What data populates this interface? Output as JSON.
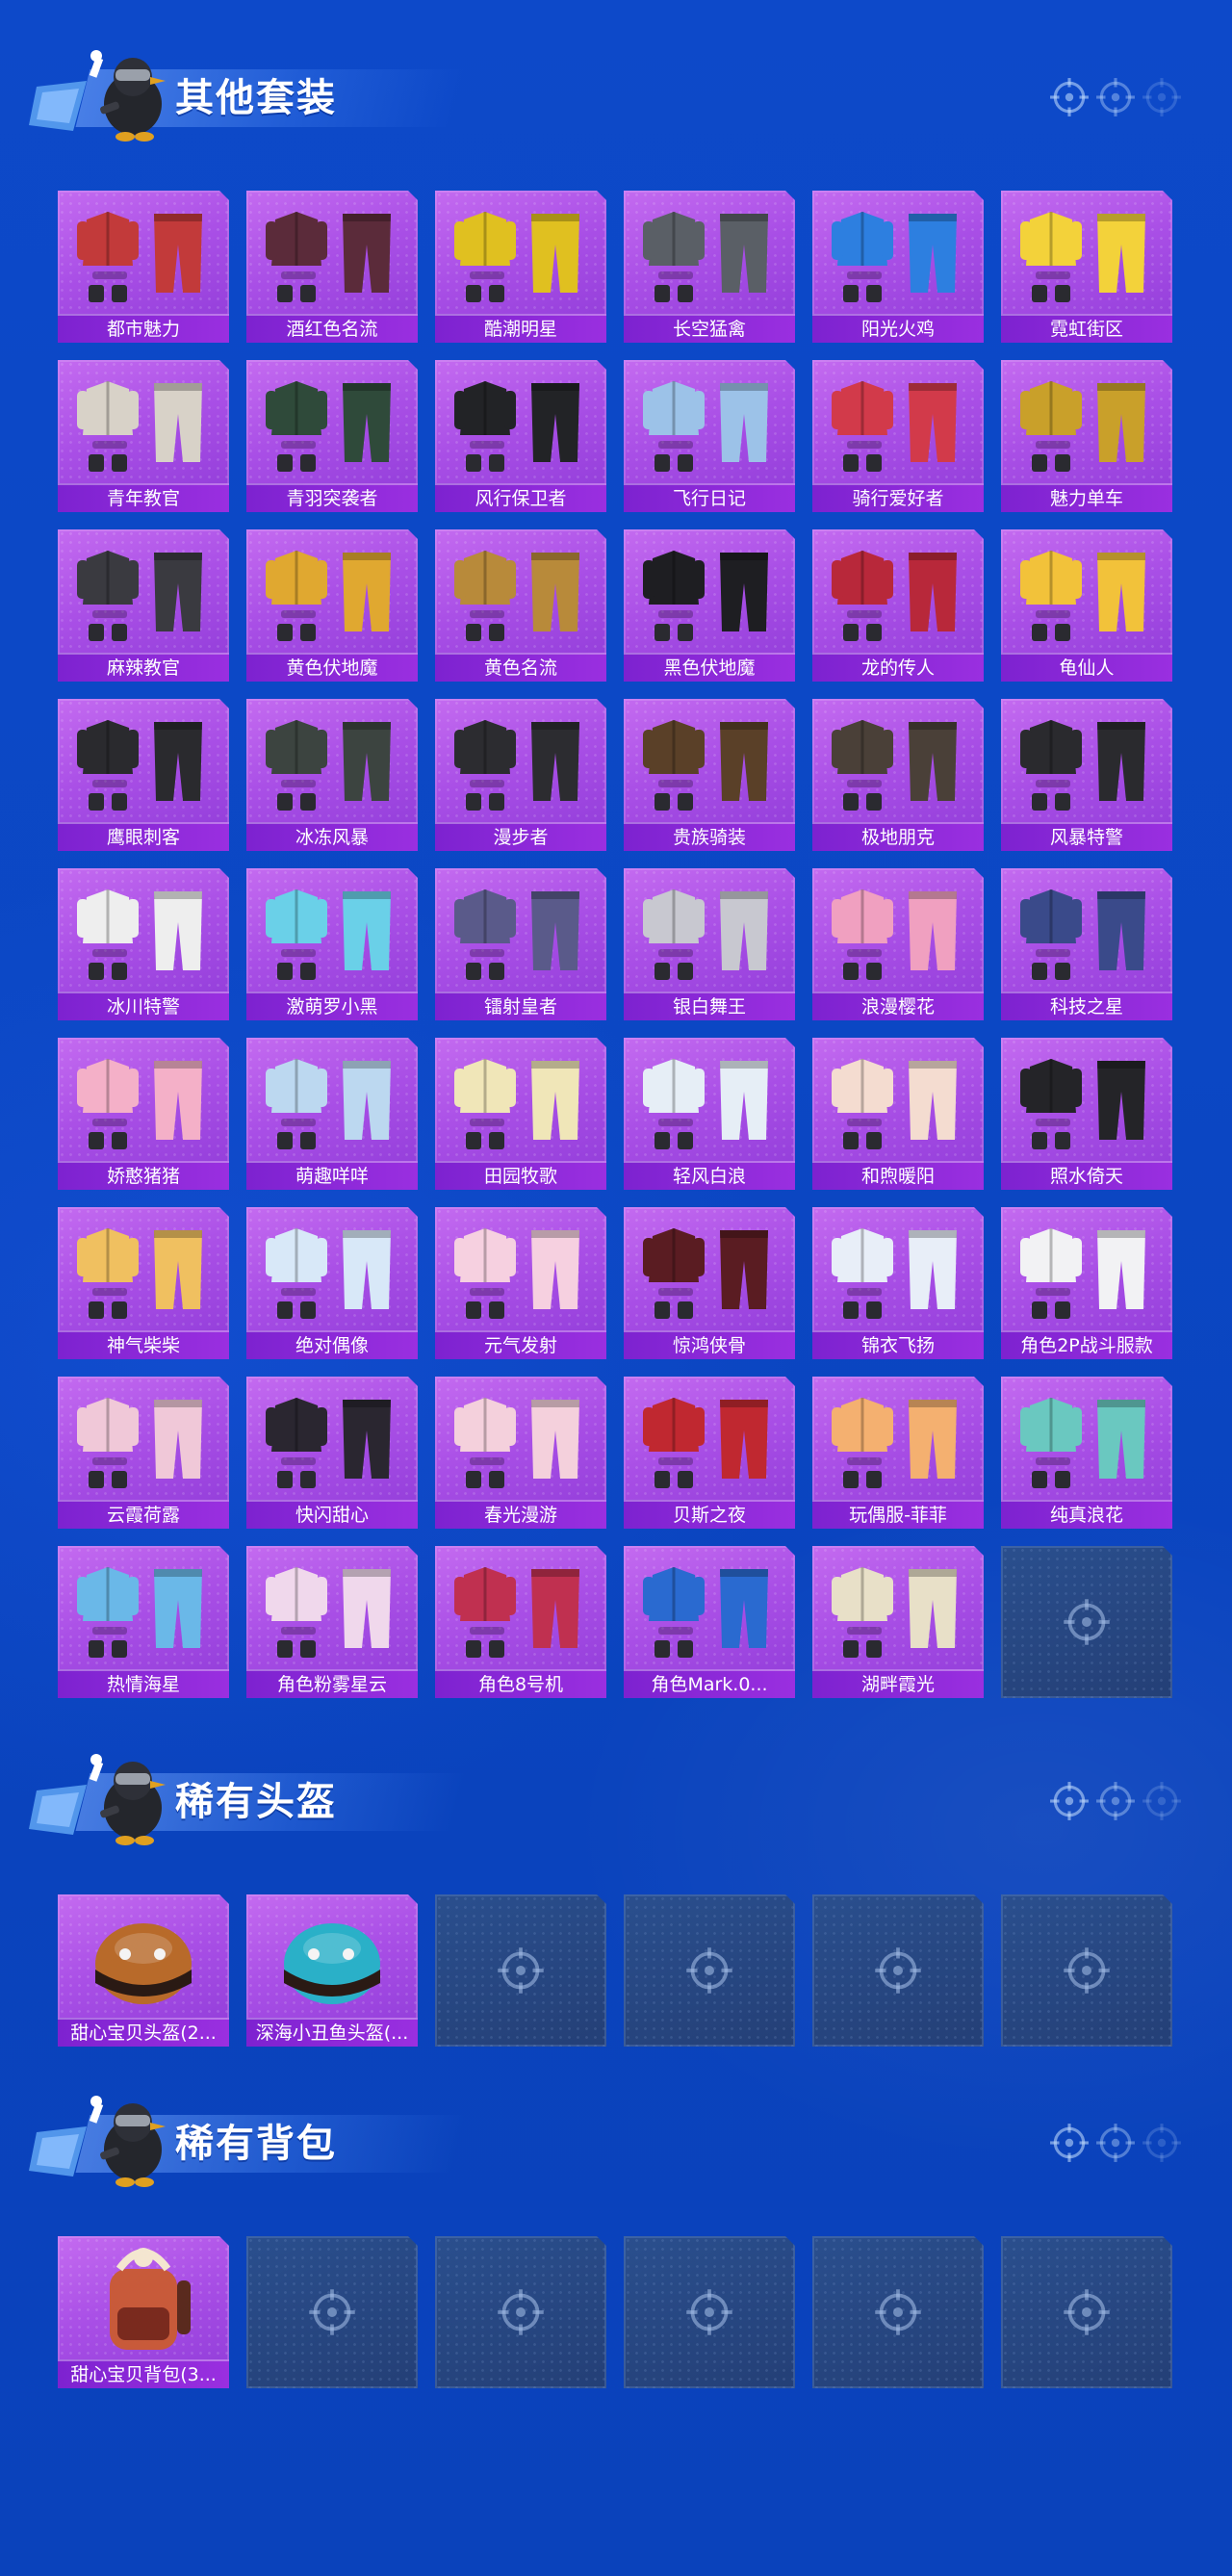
{
  "colors": {
    "background": "#0b47c4",
    "card_purple": "#a94fe6",
    "label_bar": "#8a28d8",
    "empty_slot": "#263f74"
  },
  "sections": [
    {
      "title": "其他套装",
      "items": [
        {
          "label": "都市魅力",
          "icon": "outfit-icon",
          "tint": "#c23a3a"
        },
        {
          "label": "酒红色名流",
          "icon": "outfit-icon",
          "tint": "#5b2b3a"
        },
        {
          "label": "酷潮明星",
          "icon": "outfit-icon",
          "tint": "#e0c020"
        },
        {
          "label": "长空猛禽",
          "icon": "outfit-icon",
          "tint": "#5a5f66"
        },
        {
          "label": "阳光火鸡",
          "icon": "outfit-icon",
          "tint": "#2d7fe0"
        },
        {
          "label": "霓虹街区",
          "icon": "outfit-icon",
          "tint": "#f3d23a"
        },
        {
          "label": "青年教官",
          "icon": "outfit-icon",
          "tint": "#d8d2c8"
        },
        {
          "label": "青羽突袭者",
          "icon": "outfit-icon",
          "tint": "#2f4a3a"
        },
        {
          "label": "风行保卫者",
          "icon": "outfit-icon",
          "tint": "#222326"
        },
        {
          "label": "飞行日记",
          "icon": "outfit-icon",
          "tint": "#9cc2e8"
        },
        {
          "label": "骑行爱好者",
          "icon": "outfit-icon",
          "tint": "#d23a4a"
        },
        {
          "label": "魅力单车",
          "icon": "outfit-icon",
          "tint": "#c9a02a"
        },
        {
          "label": "麻辣教官",
          "icon": "outfit-icon",
          "tint": "#3a3a40"
        },
        {
          "label": "黄色伏地魔",
          "icon": "outfit-icon",
          "tint": "#e0a830"
        },
        {
          "label": "黄色名流",
          "icon": "outfit-icon",
          "tint": "#b88a3a"
        },
        {
          "label": "黑色伏地魔",
          "icon": "outfit-icon",
          "tint": "#1e1e22"
        },
        {
          "label": "龙的传人",
          "icon": "outfit-icon",
          "tint": "#b8283a"
        },
        {
          "label": "龟仙人",
          "icon": "outfit-icon",
          "tint": "#f2c23a"
        },
        {
          "label": "鹰眼刺客",
          "icon": "outfit-icon",
          "tint": "#2a2a2e"
        },
        {
          "label": "冰冻风暴",
          "icon": "outfit-icon",
          "tint": "#3c4440"
        },
        {
          "label": "漫步者",
          "icon": "outfit-icon",
          "tint": "#2c2c30"
        },
        {
          "label": "贵族骑装",
          "icon": "outfit-icon",
          "tint": "#5a4028"
        },
        {
          "label": "极地朋克",
          "icon": "outfit-icon",
          "tint": "#4a4038"
        },
        {
          "label": "风暴特警",
          "icon": "outfit-icon",
          "tint": "#2a2a2e"
        },
        {
          "label": "冰川特警",
          "icon": "outfit-icon",
          "tint": "#eeeeee"
        },
        {
          "label": "激萌罗小黑",
          "icon": "outfit-icon",
          "tint": "#6ad0e8"
        },
        {
          "label": "镭射皇者",
          "icon": "outfit-icon",
          "tint": "#5a5a8a"
        },
        {
          "label": "银白舞王",
          "icon": "outfit-icon",
          "tint": "#c8c8d0"
        },
        {
          "label": "浪漫樱花",
          "icon": "outfit-icon",
          "tint": "#f0a0c0"
        },
        {
          "label": "科技之星",
          "icon": "outfit-icon",
          "tint": "#3a4a8a"
        },
        {
          "label": "娇憨猪猪",
          "icon": "outfit-icon",
          "tint": "#f4b0c8"
        },
        {
          "label": "萌趣咩咩",
          "icon": "outfit-icon",
          "tint": "#bcd8f0"
        },
        {
          "label": "田园牧歌",
          "icon": "outfit-icon",
          "tint": "#f0e6b8"
        },
        {
          "label": "轻风白浪",
          "icon": "outfit-icon",
          "tint": "#e6eef6"
        },
        {
          "label": "和煦暖阳",
          "icon": "outfit-icon",
          "tint": "#f4dcd0"
        },
        {
          "label": "照水倚天",
          "icon": "outfit-icon",
          "tint": "#242428"
        },
        {
          "label": "神气柴柴",
          "icon": "outfit-icon",
          "tint": "#f0c060"
        },
        {
          "label": "绝对偶像",
          "icon": "outfit-icon",
          "tint": "#d8e8f8"
        },
        {
          "label": "元气发射",
          "icon": "outfit-icon",
          "tint": "#f6d0e0"
        },
        {
          "label": "惊鸿侠骨",
          "icon": "outfit-icon",
          "tint": "#5a1c22"
        },
        {
          "label": "锦衣飞扬",
          "icon": "outfit-icon",
          "tint": "#e8eef8"
        },
        {
          "label": "角色2P战斗服款",
          "icon": "outfit-icon",
          "tint": "#f2f2f4"
        },
        {
          "label": "云霞荷露",
          "icon": "outfit-icon",
          "tint": "#f0c8d8"
        },
        {
          "label": "快闪甜心",
          "icon": "outfit-icon",
          "tint": "#2a2630"
        },
        {
          "label": "春光漫游",
          "icon": "outfit-icon",
          "tint": "#f4d0dc"
        },
        {
          "label": "贝斯之夜",
          "icon": "outfit-icon",
          "tint": "#c02830"
        },
        {
          "label": "玩偶服-菲菲",
          "icon": "outfit-icon",
          "tint": "#f4b070"
        },
        {
          "label": "纯真浪花",
          "icon": "outfit-icon",
          "tint": "#6ac8c0"
        },
        {
          "label": "热情海星",
          "icon": "outfit-icon",
          "tint": "#6ab8e8"
        },
        {
          "label": "角色粉雾星云",
          "icon": "outfit-icon",
          "tint": "#f0d8ec"
        },
        {
          "label": "角色8号机",
          "icon": "outfit-icon",
          "tint": "#c03050"
        },
        {
          "label": "角色Mark.0...",
          "icon": "outfit-icon",
          "tint": "#2a6ad0"
        },
        {
          "label": "湖畔霞光",
          "icon": "outfit-icon",
          "tint": "#e8e0c8"
        },
        {
          "empty": true,
          "icon": "target-icon"
        }
      ]
    },
    {
      "title": "稀有头盔",
      "items": [
        {
          "label": "甜心宝贝头盔(2...",
          "icon": "helmet-icon",
          "tint": "#b86a2a"
        },
        {
          "label": "深海小丑鱼头盔(...",
          "icon": "helmet-icon",
          "tint": "#2ab0c8"
        },
        {
          "empty": true,
          "icon": "target-icon"
        },
        {
          "empty": true,
          "icon": "target-icon"
        },
        {
          "empty": true,
          "icon": "target-icon"
        },
        {
          "empty": true,
          "icon": "target-icon"
        }
      ]
    },
    {
      "title": "稀有背包",
      "items": [
        {
          "label": "甜心宝贝背包(3...",
          "icon": "backpack-icon",
          "tint": "#c85a3a"
        },
        {
          "empty": true,
          "icon": "target-icon"
        },
        {
          "empty": true,
          "icon": "target-icon"
        },
        {
          "empty": true,
          "icon": "target-icon"
        },
        {
          "empty": true,
          "icon": "target-icon"
        },
        {
          "empty": true,
          "icon": "target-icon"
        }
      ]
    }
  ]
}
